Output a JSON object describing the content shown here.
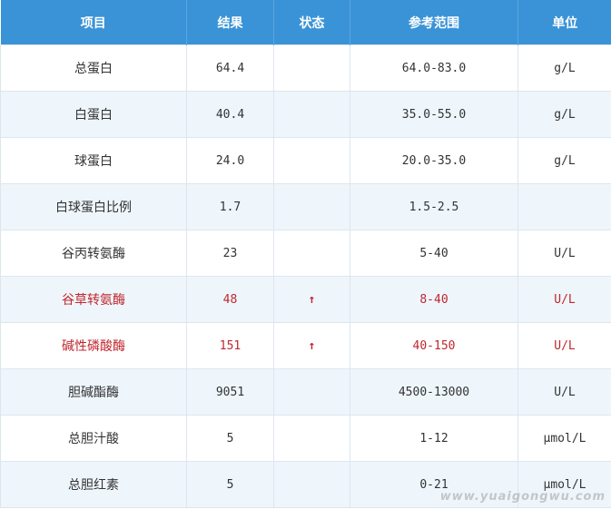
{
  "colors": {
    "header_bg": "#3a93d6",
    "row_alt": "#eef6fc",
    "alert_text": "#c0272d"
  },
  "table": {
    "headers": [
      "项目",
      "结果",
      "状态",
      "参考范围",
      "单位"
    ],
    "rows": [
      {
        "item": "总蛋白",
        "result": "64.4",
        "status": "",
        "range": "64.0-83.0",
        "unit": "g/L"
      },
      {
        "item": "白蛋白",
        "result": "40.4",
        "status": "",
        "range": "35.0-55.0",
        "unit": "g/L"
      },
      {
        "item": "球蛋白",
        "result": "24.0",
        "status": "",
        "range": "20.0-35.0",
        "unit": "g/L"
      },
      {
        "item": "白球蛋白比例",
        "result": "1.7",
        "status": "",
        "range": "1.5-2.5",
        "unit": ""
      },
      {
        "item": "谷丙转氨酶",
        "result": "23",
        "status": "",
        "range": "5-40",
        "unit": "U/L"
      },
      {
        "item": "谷草转氨酶",
        "result": "48",
        "status": "↑",
        "range": "8-40",
        "unit": "U/L"
      },
      {
        "item": "碱性磷酸酶",
        "result": "151",
        "status": "↑",
        "range": "40-150",
        "unit": "U/L"
      },
      {
        "item": "胆碱酯酶",
        "result": "9051",
        "status": "",
        "range": "4500-13000",
        "unit": "U/L"
      },
      {
        "item": "总胆汁酸",
        "result": "5",
        "status": "",
        "range": "1-12",
        "unit": "μmol/L"
      },
      {
        "item": "总胆红素",
        "result": "5",
        "status": "",
        "range": "0-21",
        "unit": "μmol/L"
      }
    ]
  },
  "watermark": "www.yuaigongwu.com"
}
